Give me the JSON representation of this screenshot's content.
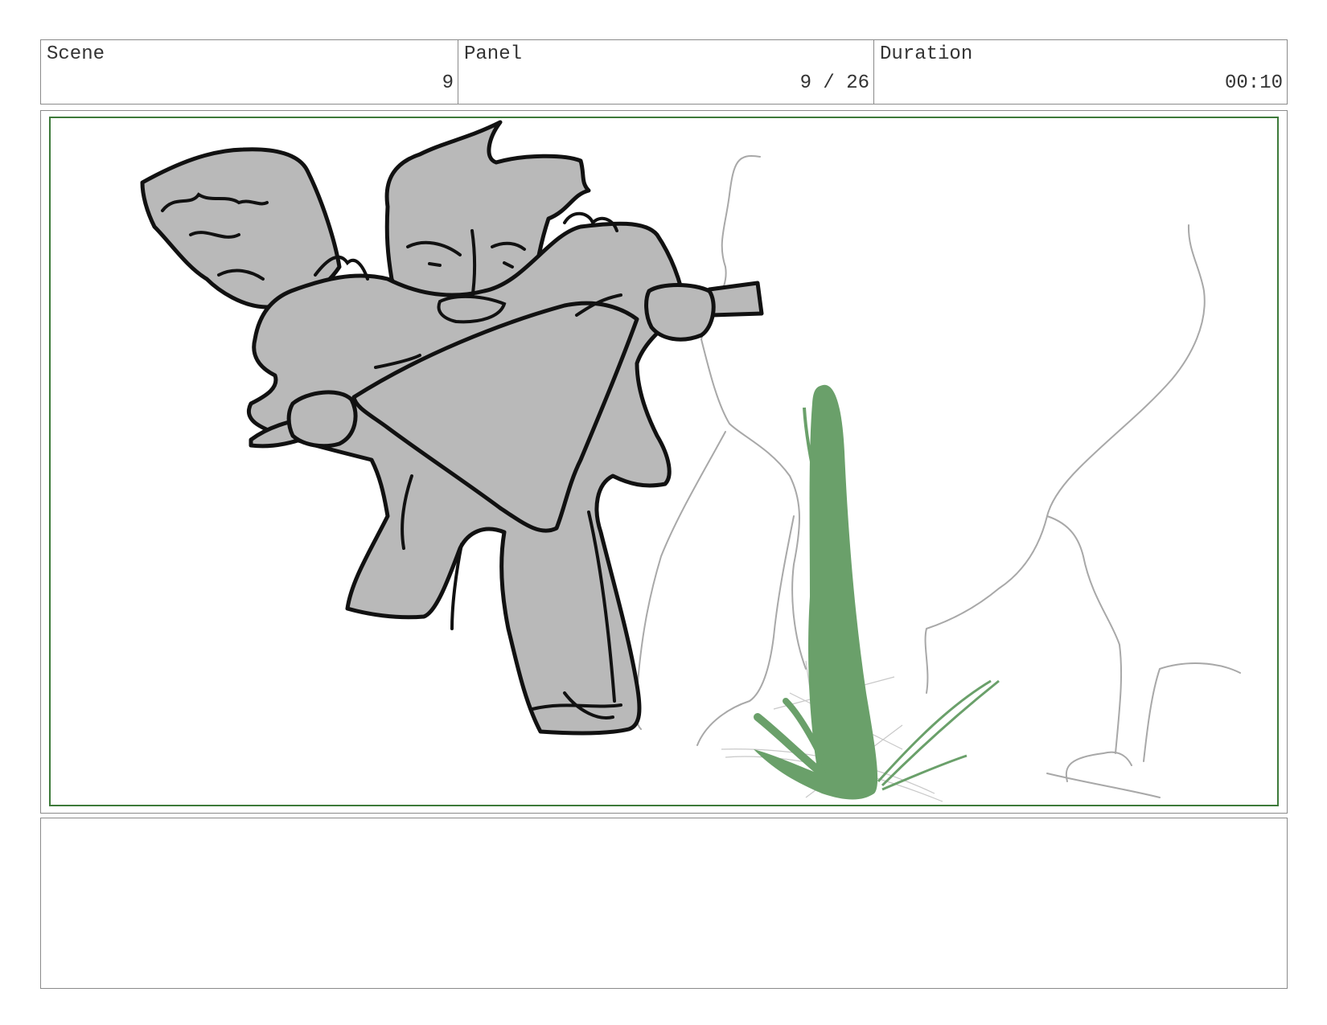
{
  "header": {
    "scene": {
      "label": "Scene",
      "value": "9"
    },
    "panel": {
      "label": "Panel",
      "value": "9 / 26"
    },
    "duration": {
      "label": "Duration",
      "value": "00:10"
    }
  },
  "notes": {
    "text": ""
  },
  "colors": {
    "frame_border": "#8a8a8a",
    "canvas_border": "#3d7a3a",
    "figure_fill": "#b9b9b9",
    "ink": "#111111",
    "background_sketch": "#a8a8a8",
    "arrow_green": "#6aa06a"
  },
  "illustration": {
    "subject": "rough storyboard sketch: gray character swinging a large triangular blade/axe, green downward arrow striking the ground, faint gray rock outlines in background",
    "icons": [
      "character-sketch",
      "motion-arrow-icon",
      "rock-outline"
    ]
  }
}
